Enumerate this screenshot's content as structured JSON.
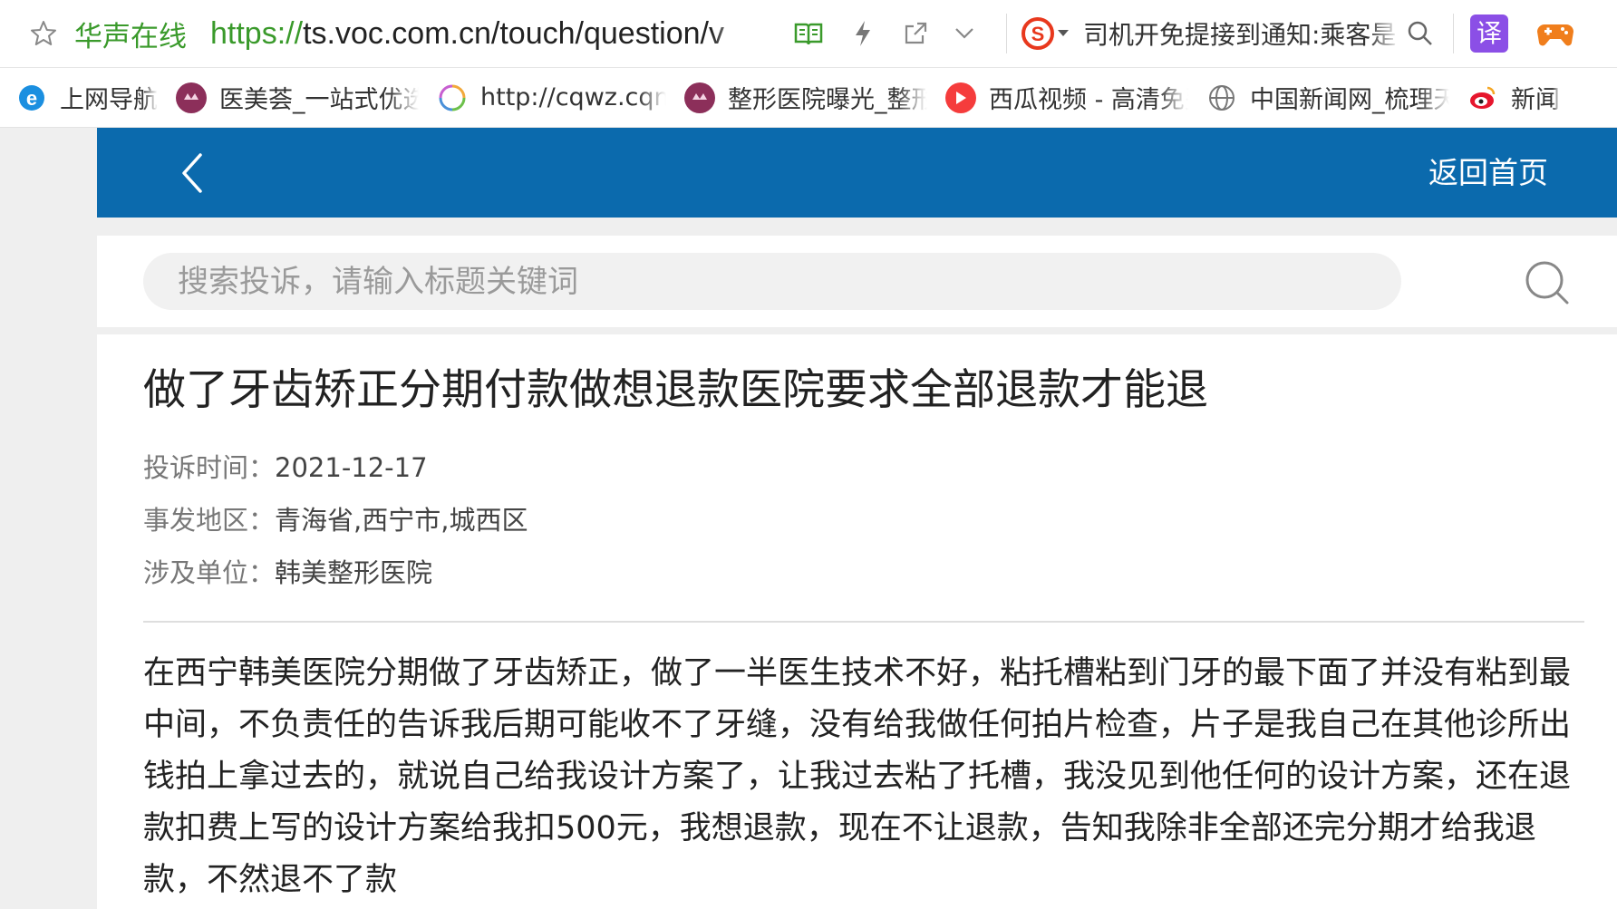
{
  "browser": {
    "site_name": "华声在线",
    "url_protocol": "https://",
    "url_rest": "ts.voc.com.cn/touch/question/v",
    "sogou_query": "司机开免提接到通知:乘客是"
  },
  "bookmarks": [
    {
      "label": "上网导航",
      "icon": "ie-icon"
    },
    {
      "label": "医美荟_一站式优选",
      "icon": "yimeihui-icon"
    },
    {
      "label": "http://cqwz.cqnews",
      "icon": "loading-icon"
    },
    {
      "label": "整形医院曝光_整形",
      "icon": "yimeihui-icon"
    },
    {
      "label": "西瓜视频 - 高清免费",
      "icon": "xigua-icon"
    },
    {
      "label": "中国新闻网_梳理天",
      "icon": "globe-icon"
    },
    {
      "label": "新闻",
      "icon": "weibo-icon"
    }
  ],
  "header": {
    "home_label": "返回首页"
  },
  "search": {
    "placeholder": "搜索投诉，请输入标题关键词"
  },
  "article": {
    "title": "做了牙齿矫正分期付款做想退款医院要求全部退款才能退",
    "meta": [
      {
        "key": "投诉时间：",
        "value": "2021-12-17"
      },
      {
        "key": "事发地区：",
        "value": "青海省,西宁市,城西区"
      },
      {
        "key": "涉及单位：",
        "value": "韩美整形医院"
      }
    ],
    "body": "在西宁韩美医院分期做了牙齿矫正，做了一半医生技术不好，粘托槽粘到门牙的最下面了并没有粘到最中间，不负责任的告诉我后期可能收不了牙缝，没有给我做任何拍片检查，片子是我自己在其他诊所出钱拍上拿过去的，就说自己给我设计方案了，让我过去粘了托槽，我没见到他任何的设计方案，还在退款扣费上写的设计方案给我扣500元，我想退款，现在不让退款，告知我除非全部还完分期才给我退款，不然退不了款"
  },
  "colors": {
    "header_blue": "#0b6aad",
    "site_green": "#3a9a2b"
  }
}
